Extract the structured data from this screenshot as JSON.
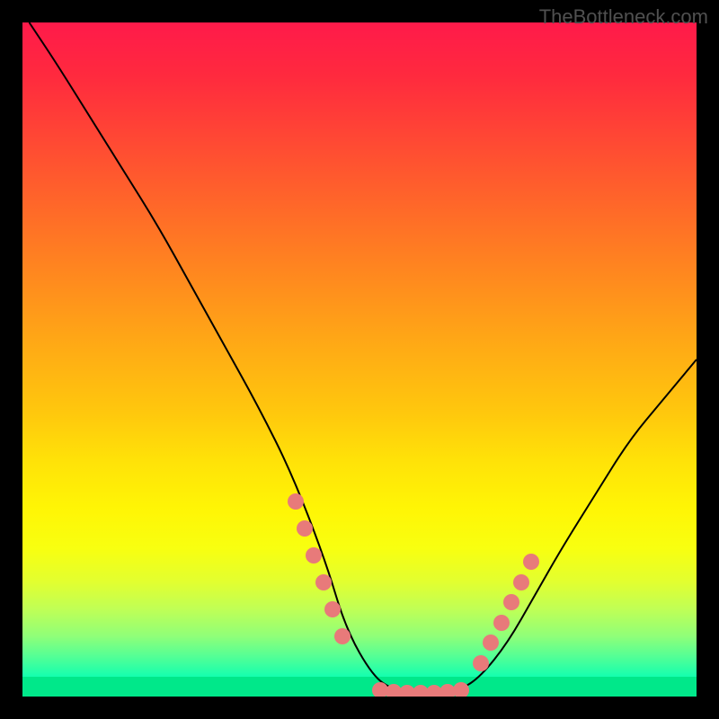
{
  "watermark": "TheBottleneck.com",
  "chart_data": {
    "type": "line",
    "title": "",
    "xlabel": "",
    "ylabel": "",
    "xlim": [
      0,
      100
    ],
    "ylim": [
      0,
      100
    ],
    "series": [
      {
        "name": "curve",
        "x": [
          1,
          5,
          10,
          15,
          20,
          25,
          30,
          35,
          40,
          45,
          48,
          52,
          55,
          58,
          62,
          65,
          68,
          72,
          76,
          80,
          85,
          90,
          95,
          100
        ],
        "y": [
          100,
          94,
          86,
          78,
          70,
          61,
          52,
          43,
          33,
          20,
          10,
          3,
          1,
          0.5,
          0.5,
          1,
          3,
          8,
          15,
          22,
          30,
          38,
          44,
          50
        ]
      }
    ],
    "dots_left": {
      "x": [
        40.5,
        41.8,
        43.2,
        44.6,
        46.0,
        47.5
      ],
      "y": [
        29,
        25,
        21,
        17,
        13,
        9
      ]
    },
    "dots_bottom": {
      "x": [
        53,
        55,
        57,
        59,
        61,
        63,
        65
      ],
      "y": [
        1,
        0.7,
        0.5,
        0.5,
        0.5,
        0.7,
        1
      ]
    },
    "dots_right": {
      "x": [
        68,
        69.5,
        71,
        72.5,
        74,
        75.5
      ],
      "y": [
        5,
        8,
        11,
        14,
        17,
        20
      ]
    },
    "background_gradient": {
      "top": "#ff1a4a",
      "mid": "#ffe208",
      "bottom": "#00e88a"
    }
  }
}
